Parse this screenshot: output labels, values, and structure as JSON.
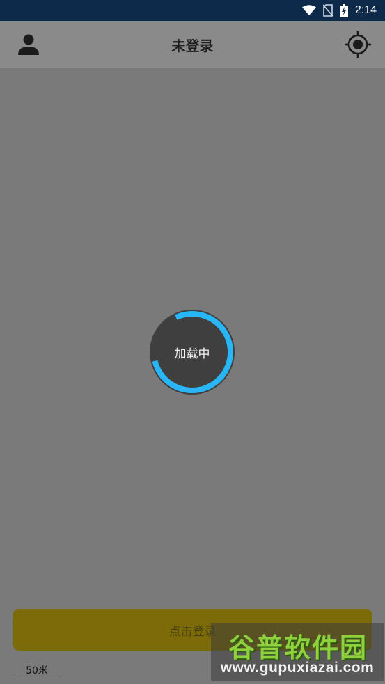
{
  "status_bar": {
    "time": "2:14",
    "icons": [
      "wifi-icon",
      "no-sim-icon",
      "battery-charging-icon"
    ]
  },
  "header": {
    "title": "未登录",
    "left_icon": "user-icon",
    "right_icon": "locate-icon"
  },
  "loading": {
    "label": "加载中"
  },
  "login": {
    "label": "点击登录"
  },
  "map_scale": {
    "label": "50米"
  },
  "watermark": {
    "title": "谷普软件园",
    "url": "www.gupuxiazai.com"
  },
  "colors": {
    "status_bar": "#0d2a4a",
    "map_overlay": "#7a7a7a",
    "spinner_accent": "#29b6f6",
    "login_button": "#7d6a08"
  }
}
